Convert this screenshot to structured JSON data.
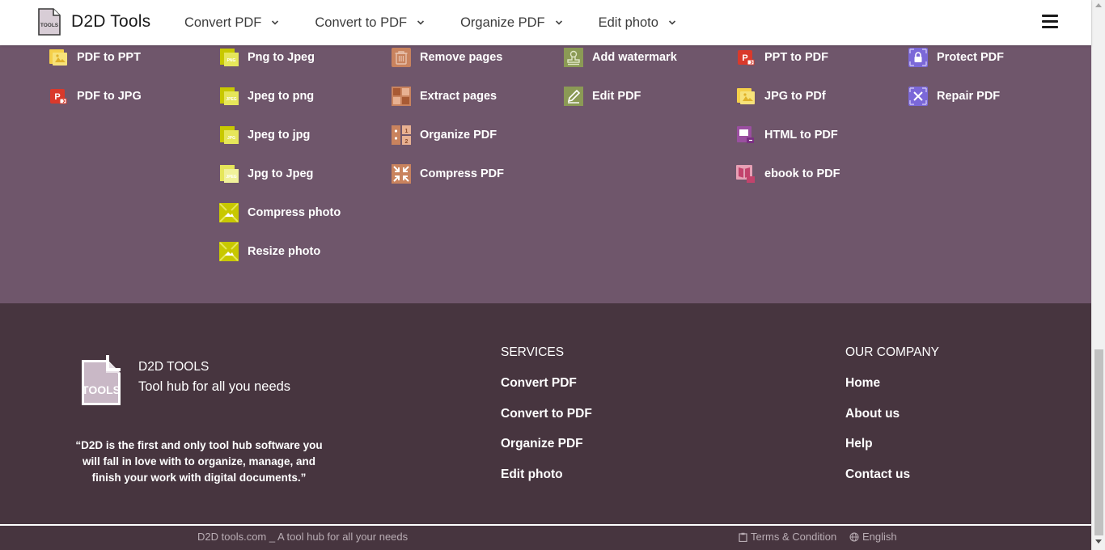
{
  "header": {
    "brand_name": "D2D Tools",
    "logo_text": "TOOLS",
    "nav": [
      {
        "label": "Convert PDF"
      },
      {
        "label": "Convert to PDF"
      },
      {
        "label": "Organize PDF"
      },
      {
        "label": "Edit photo"
      }
    ]
  },
  "tools": {
    "col1": [
      {
        "label": "PDF to PPT",
        "icon": "pdf-to-ppt-icon"
      },
      {
        "label": "PDF to JPG",
        "icon": "pdf-to-jpg-icon"
      }
    ],
    "col2": [
      {
        "label": "Png to Jpeg",
        "icon": "png-to-jpeg-icon",
        "badge": "PNG"
      },
      {
        "label": "Jpeg to png",
        "icon": "jpeg-to-png-icon",
        "badge": "JPEG"
      },
      {
        "label": "Jpeg to jpg",
        "icon": "jpeg-to-jpg-icon",
        "badge": "JPG"
      },
      {
        "label": "Jpg to Jpeg",
        "icon": "jpg-to-jpeg-icon",
        "badge": "JPEG"
      },
      {
        "label": "Compress photo",
        "icon": "compress-photo-icon"
      },
      {
        "label": "Resize photo",
        "icon": "resize-photo-icon"
      }
    ],
    "col3": [
      {
        "label": "Remove pages",
        "icon": "trash-icon"
      },
      {
        "label": "Extract pages",
        "icon": "extract-pages-icon"
      },
      {
        "label": "Organize PDF",
        "icon": "organize-pdf-icon"
      },
      {
        "label": "Compress PDF",
        "icon": "compress-pdf-icon"
      }
    ],
    "col4": [
      {
        "label": "Add watermark",
        "icon": "watermark-stamp-icon"
      },
      {
        "label": "Edit PDF",
        "icon": "edit-pdf-icon"
      }
    ],
    "col5": [
      {
        "label": "PPT to PDF",
        "icon": "ppt-to-pdf-icon"
      },
      {
        "label": "JPG to PDf",
        "icon": "jpg-to-pdf-icon"
      },
      {
        "label": "HTML to PDF",
        "icon": "html-to-pdf-icon"
      },
      {
        "label": "ebook to PDF",
        "icon": "ebook-to-pdf-icon"
      }
    ],
    "col6": [
      {
        "label": "Protect PDF",
        "icon": "lock-icon"
      },
      {
        "label": "Repair PDF",
        "icon": "repair-tools-icon"
      }
    ]
  },
  "footer": {
    "brand": "D2D TOOLS",
    "logo_text": "TOOLS",
    "tagline": "Tool hub for all you needs",
    "quote": "“D2D is the first and only tool hub software you will fall in love with to organize, manage, and finish your work with digital documents.”",
    "services": {
      "title": "SERVICES",
      "links": [
        "Convert PDF",
        "Convert to PDF",
        "Organize PDF",
        "Edit photo"
      ]
    },
    "company": {
      "title": "OUR COMPANY",
      "links": [
        "Home",
        "About us",
        "Help",
        "Contact us"
      ]
    }
  },
  "bottom": {
    "copyright": "D2D tools.com _ A tool hub for all your needs",
    "terms": "Terms & Condition",
    "language": "English"
  },
  "colors": {
    "tools_bg": "#6f566b",
    "footer_bg": "#47353f",
    "photo_icon": "#c8c800",
    "pdf_red": "#d9392b",
    "organize_orange": "#c9835e",
    "edit_green": "#8b9a55",
    "protect_purple": "#7b68d8",
    "html_purple": "#9a4fa0",
    "ebook_pink": "#c2436c"
  }
}
